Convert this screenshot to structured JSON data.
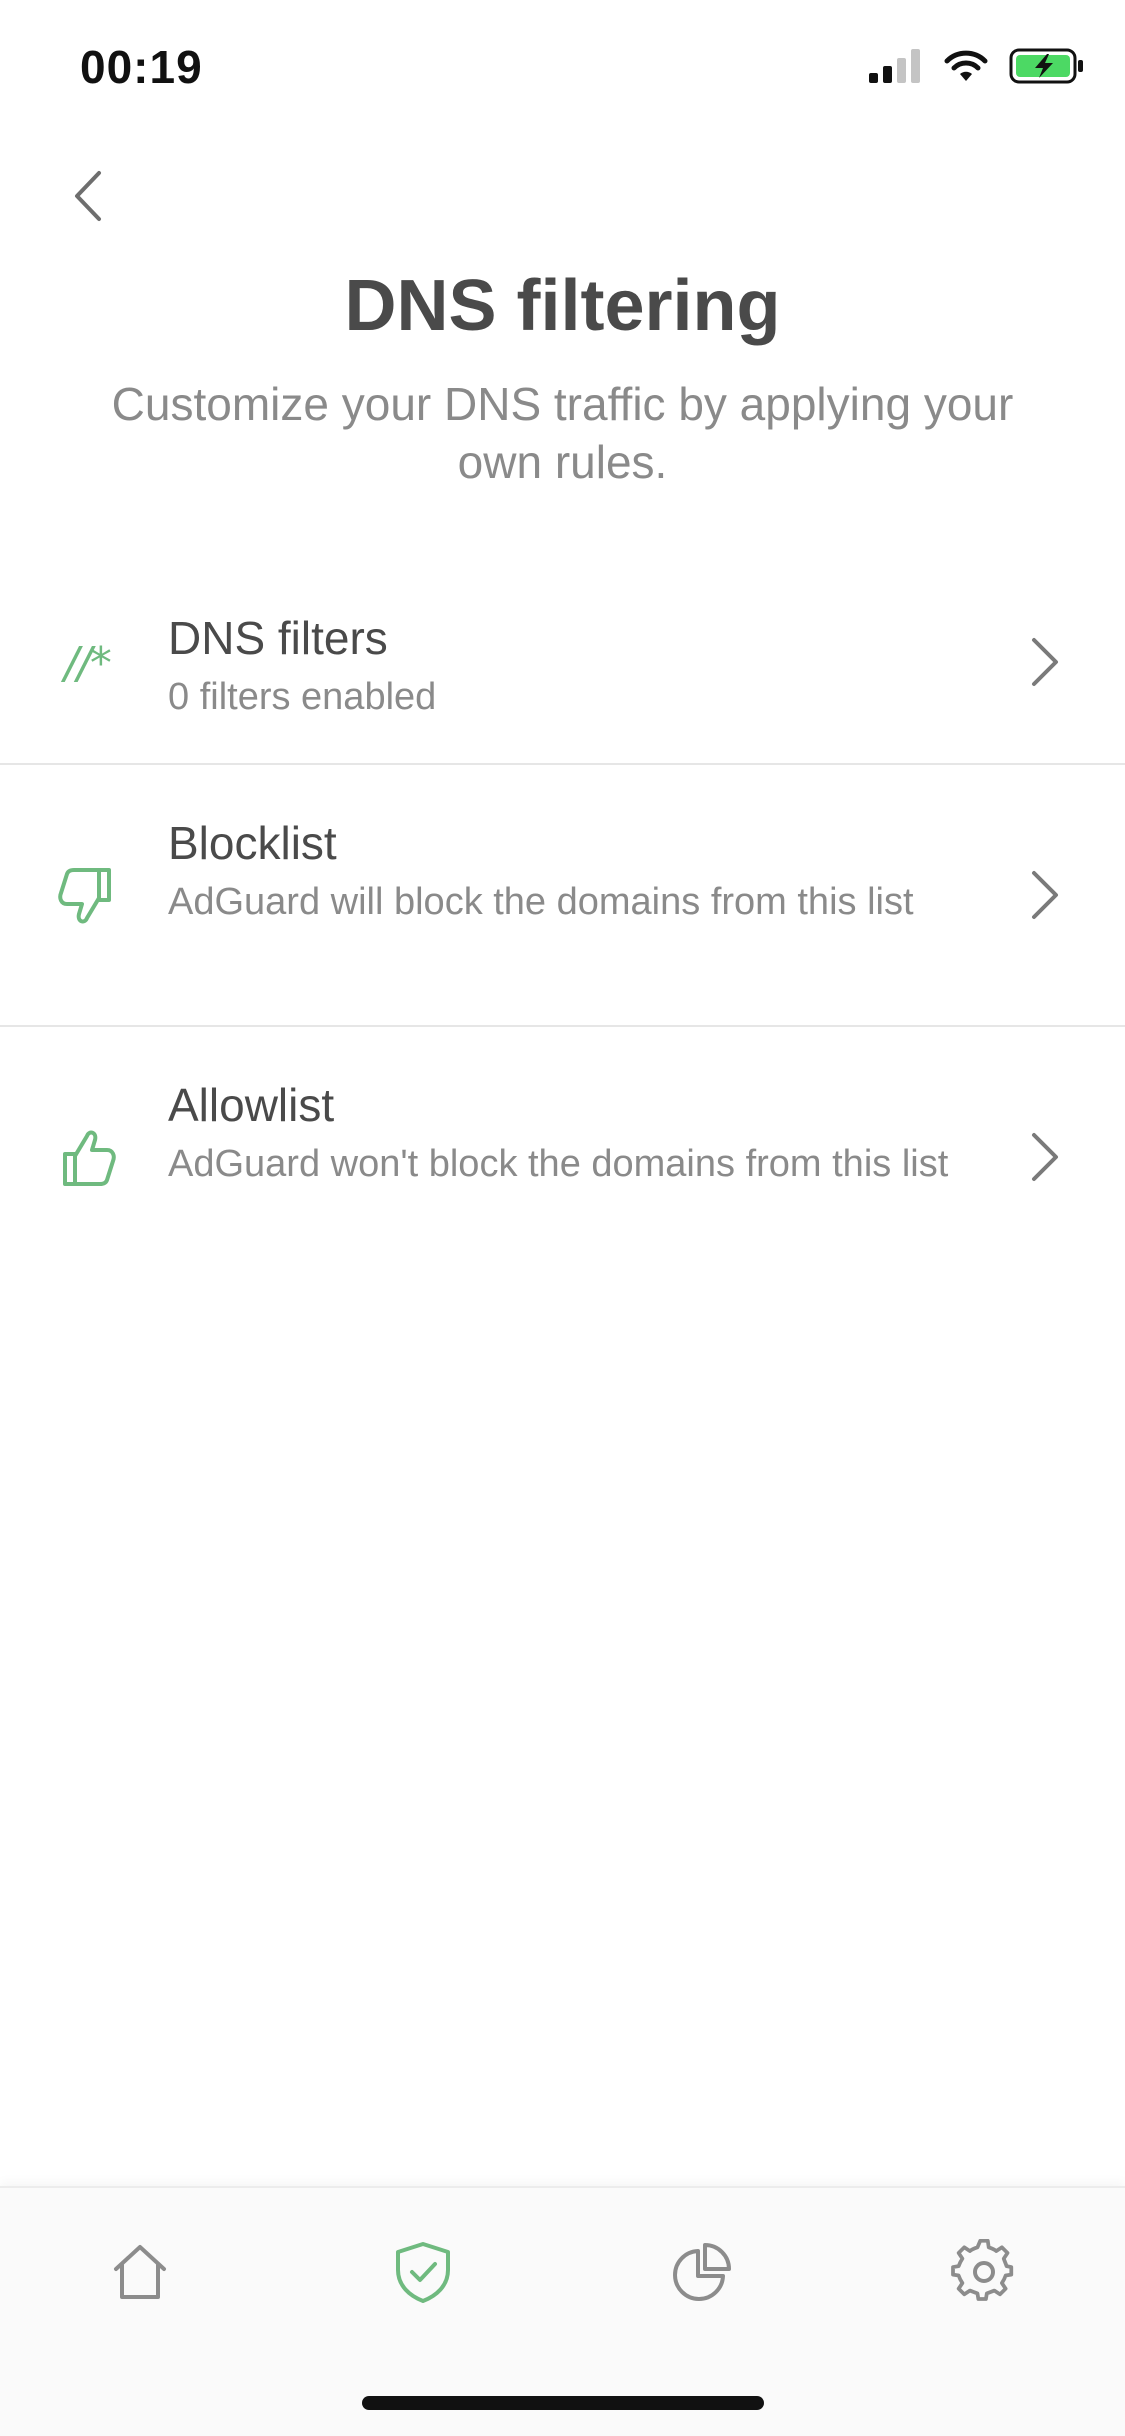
{
  "status_bar": {
    "time": "00:19",
    "icons": [
      "signal-icon",
      "wifi-icon",
      "battery-charging-icon"
    ]
  },
  "header": {
    "title": "DNS filtering",
    "subtitle": "Customize your DNS traffic by applying your own rules."
  },
  "menu": {
    "items": [
      {
        "icon": "filters-icon",
        "icon_glyph": "//*",
        "title": "DNS filters",
        "description": "0 filters enabled"
      },
      {
        "icon": "thumbs-down-icon",
        "title": "Blocklist",
        "description": "AdGuard will block the domains from this list"
      },
      {
        "icon": "thumbs-up-icon",
        "title": "Allowlist",
        "description": "AdGuard won't block the domains from this list"
      }
    ]
  },
  "tab_bar": {
    "tabs": [
      {
        "icon": "home-icon",
        "active": false
      },
      {
        "icon": "shield-check-icon",
        "active": true
      },
      {
        "icon": "pie-chart-icon",
        "active": false
      },
      {
        "icon": "gear-icon",
        "active": false
      }
    ]
  },
  "colors": {
    "accent": "#6fba7f",
    "text_primary": "#4a4a4a",
    "text_secondary": "#8a8a8a",
    "icon_inactive": "#8c8c8c"
  }
}
